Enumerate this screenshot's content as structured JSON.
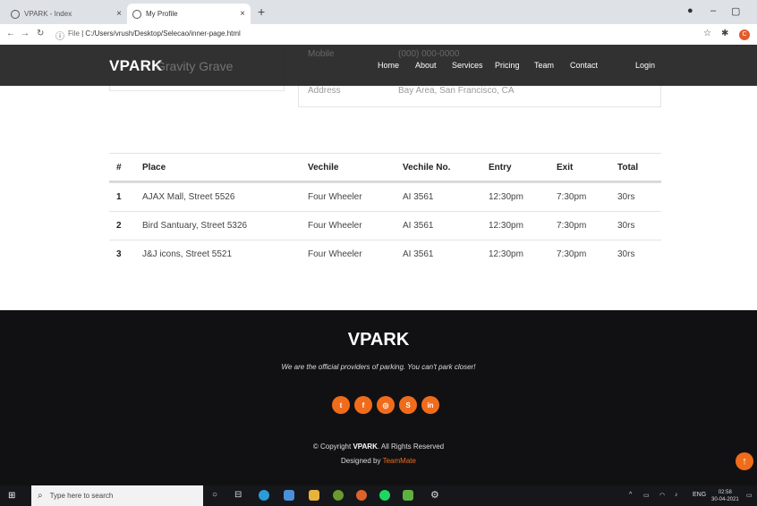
{
  "browser": {
    "tabs": [
      {
        "title": "VPARK - Index"
      },
      {
        "title": "My Profile"
      }
    ],
    "new_tab": "+",
    "close_glyph": "×",
    "url_prefix": "File",
    "url": "C:/Users/vrush/Desktop/Selecao/inner-page.html",
    "profile_initial": "C"
  },
  "header": {
    "logo": "VPARK",
    "ghost_name": "Gravity Grave",
    "ghost_mobile": "Mobile",
    "ghost_phone": "(000) 000-0000",
    "nav": [
      "Home",
      "About",
      "Services",
      "Pricing",
      "Team",
      "Contact",
      "Login"
    ]
  },
  "profile_card": {
    "address_label": "Address",
    "address_value": "Bay Area, San Francisco, CA"
  },
  "table": {
    "headers": [
      "#",
      "Place",
      "Vechile",
      "Vechile No.",
      "Entry",
      "Exit",
      "Total"
    ],
    "rows": [
      [
        "1",
        "AJAX Mall, Street 5526",
        "Four Wheeler",
        "AI 3561",
        "12:30pm",
        "7:30pm",
        "30rs"
      ],
      [
        "2",
        "Bird Santuary, Street 5326",
        "Four Wheeler",
        "AI 3561",
        "12:30pm",
        "7:30pm",
        "30rs"
      ],
      [
        "3",
        "J&J icons, Street 5521",
        "Four Wheeler",
        "AI 3561",
        "12:30pm",
        "7:30pm",
        "30rs"
      ]
    ]
  },
  "footer": {
    "logo": "VPARK",
    "tagline": "We are the official providers of parking. You can't park closer!",
    "socials": [
      {
        "icon": "twitter-icon",
        "glyph": "t"
      },
      {
        "icon": "facebook-icon",
        "glyph": "f"
      },
      {
        "icon": "instagram-icon",
        "glyph": "◎"
      },
      {
        "icon": "skype-icon",
        "glyph": "S"
      },
      {
        "icon": "linkedin-icon",
        "glyph": "in"
      }
    ],
    "copyright_prefix": "© Copyright",
    "copyright_brand": "VPARK",
    "copyright_suffix": ". All Rights Reserved",
    "designed_by": "Designed by",
    "designer": "TeamMate",
    "accent": "#f06c1b"
  },
  "taskbar": {
    "search_placeholder": "Type here to search",
    "lang": "ENG",
    "time": "02:58",
    "date": "30-04-2021"
  }
}
